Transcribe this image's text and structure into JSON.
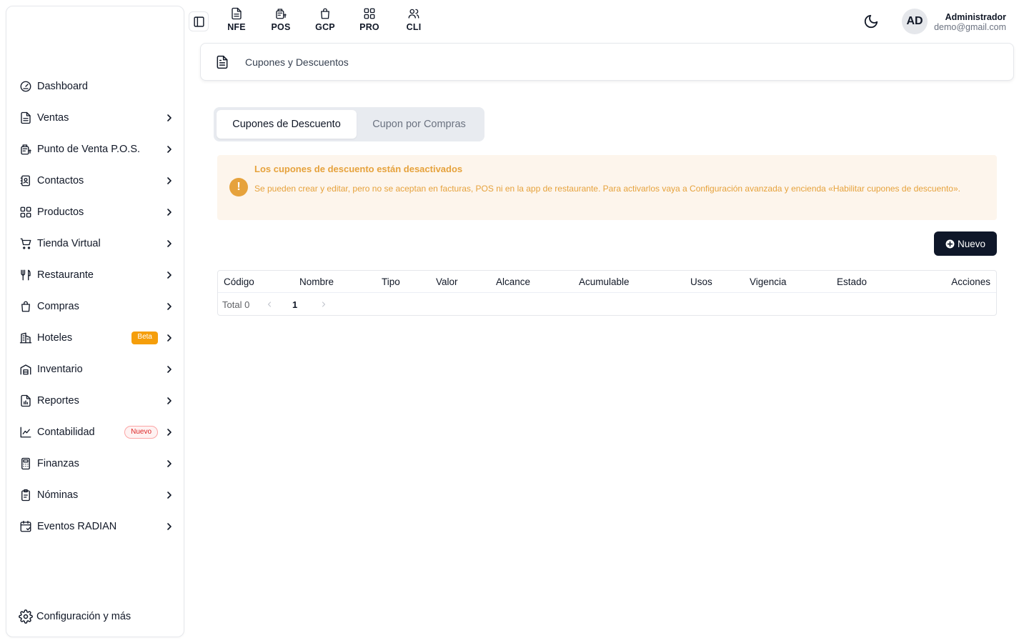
{
  "sidebar": {
    "items": [
      {
        "label": "Dashboard",
        "icon": "gauge-icon",
        "chevron": false
      },
      {
        "label": "Ventas",
        "icon": "document-icon",
        "chevron": true
      },
      {
        "label": "Punto de Venta P.O.S.",
        "icon": "receipt-icon",
        "chevron": true
      },
      {
        "label": "Contactos",
        "icon": "contact-book-icon",
        "chevron": true
      },
      {
        "label": "Productos",
        "icon": "grid-icon",
        "chevron": true
      },
      {
        "label": "Tienda Virtual",
        "icon": "cart-icon",
        "chevron": true
      },
      {
        "label": "Restaurante",
        "icon": "utensils-icon",
        "chevron": true
      },
      {
        "label": "Compras",
        "icon": "shopping-bag-icon",
        "chevron": true
      },
      {
        "label": "Hoteles",
        "icon": "building-icon",
        "chevron": true,
        "badge": "Beta"
      },
      {
        "label": "Inventario",
        "icon": "warehouse-icon",
        "chevron": true
      },
      {
        "label": "Reportes",
        "icon": "report-icon",
        "chevron": true
      },
      {
        "label": "Contabilidad",
        "icon": "chart-line-icon",
        "chevron": true,
        "badge": "Nuevo"
      },
      {
        "label": "Finanzas",
        "icon": "calculator-icon",
        "chevron": true
      },
      {
        "label": "Nóminas",
        "icon": "clipboard-icon",
        "chevron": true
      },
      {
        "label": "Eventos RADIAN",
        "icon": "calendar-icon",
        "chevron": true
      }
    ],
    "footer": {
      "label": "Configuración y más",
      "icon": "gear-icon"
    }
  },
  "topbar": {
    "apps": [
      {
        "label": "NFE",
        "icon": "document-icon"
      },
      {
        "label": "POS",
        "icon": "receipt-icon"
      },
      {
        "label": "GCP",
        "icon": "shopping-bag-icon"
      },
      {
        "label": "PRO",
        "icon": "grid-icon"
      },
      {
        "label": "CLI",
        "icon": "users-icon"
      }
    ],
    "user": {
      "initials": "AD",
      "name": "Administrador",
      "email": "demo@gmail.com"
    }
  },
  "breadcrumb": {
    "title": "Cupones y Descuentos"
  },
  "tabs": [
    {
      "label": "Cupones de Descuento",
      "active": true
    },
    {
      "label": "Cupon por Compras",
      "active": false
    }
  ],
  "alert": {
    "title": "Los cupones de descuento están desactivados",
    "description": "Se pueden crear y editar, pero no se aceptan en facturas, POS ni en la app de restaurante. Para activarlos vaya a Configuración avanzada y encienda «Habilitar cupones de descuento».",
    "icon_text": "!"
  },
  "new_button": {
    "label": "Nuevo"
  },
  "table": {
    "columns": [
      "Código",
      "Nombre",
      "Tipo",
      "Valor",
      "Alcance",
      "Acumulable",
      "Usos",
      "Vigencia",
      "Estado",
      "Acciones"
    ],
    "rows": [],
    "total_label": "Total 0",
    "current_page": "1"
  },
  "colors": {
    "accent_dark": "#0f1729",
    "warning": "#e6a23c",
    "warning_bg": "#fdf5ec",
    "beta_badge": "#f59e0b",
    "new_badge": "#dc2626"
  }
}
